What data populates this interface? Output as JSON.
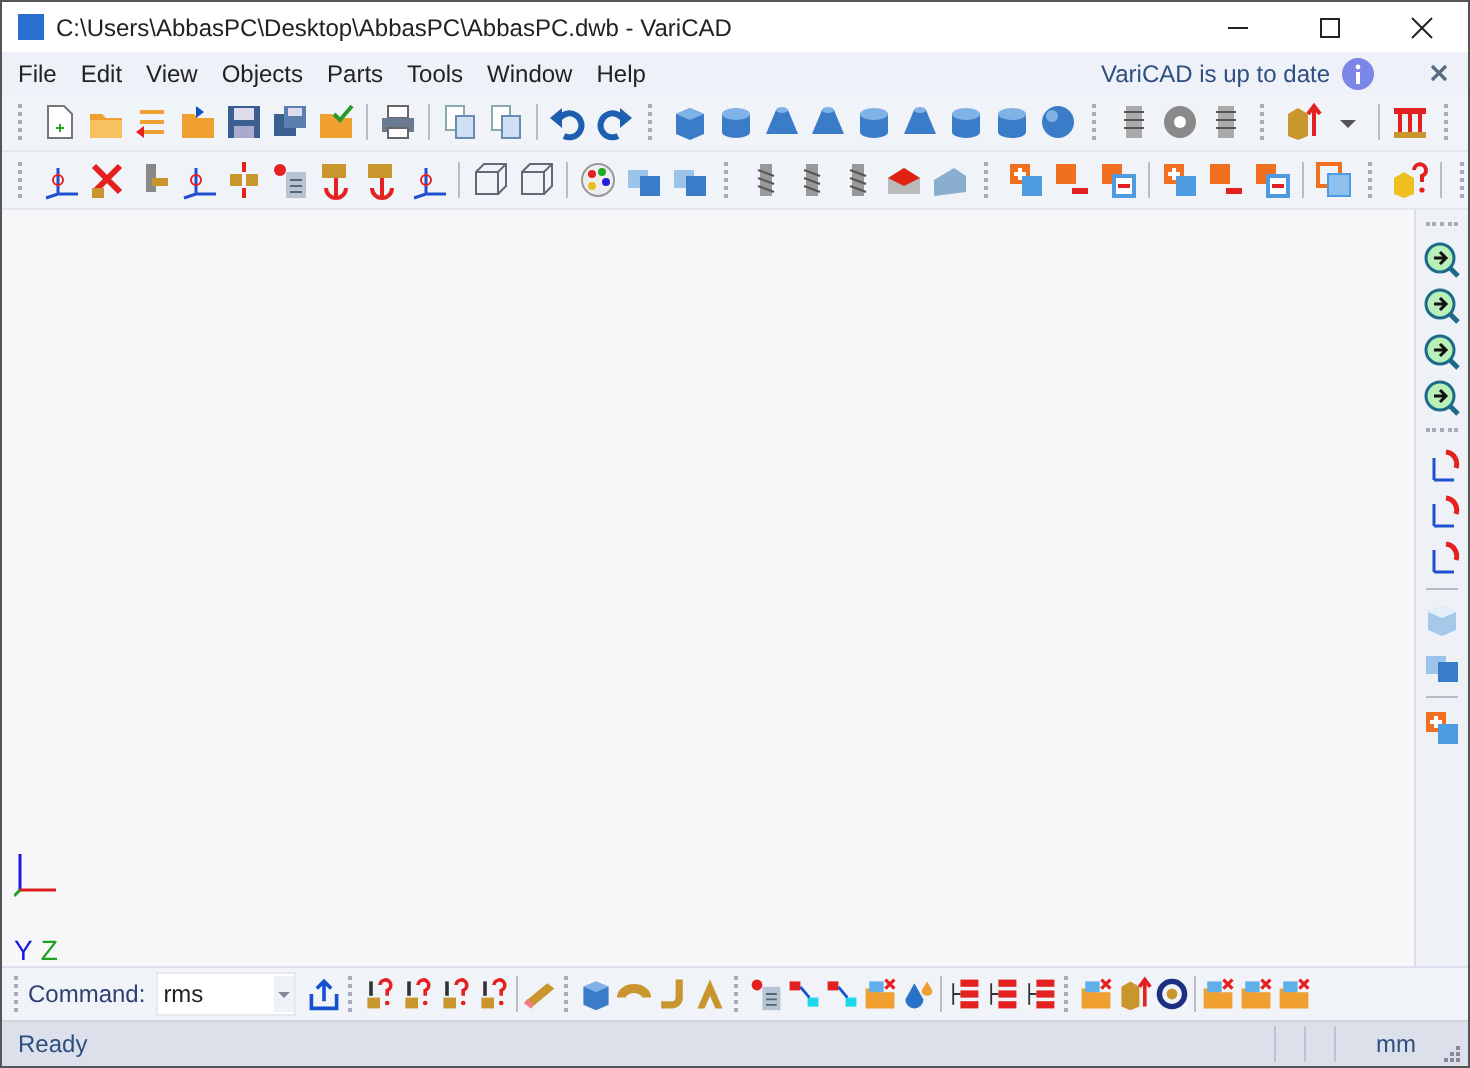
{
  "window": {
    "title": "C:\\Users\\AbbasPC\\Desktop\\AbbasPC\\AbbasPC.dwb - VariCAD"
  },
  "menu": [
    {
      "label": "File"
    },
    {
      "label": "Edit"
    },
    {
      "label": "View"
    },
    {
      "label": "Objects"
    },
    {
      "label": "Parts"
    },
    {
      "label": "Tools"
    },
    {
      "label": "Window"
    },
    {
      "label": "Help"
    }
  ],
  "notification": {
    "text": "VariCAD is up to date"
  },
  "axes": {
    "labels": [
      {
        "text": "Y",
        "color": "#1a1adf"
      },
      {
        "text": "Z",
        "color": "#1fa01f"
      }
    ]
  },
  "command_bar": {
    "label": "Command:",
    "value": "rms"
  },
  "status_bar": {
    "text": "Ready",
    "units": "mm"
  }
}
